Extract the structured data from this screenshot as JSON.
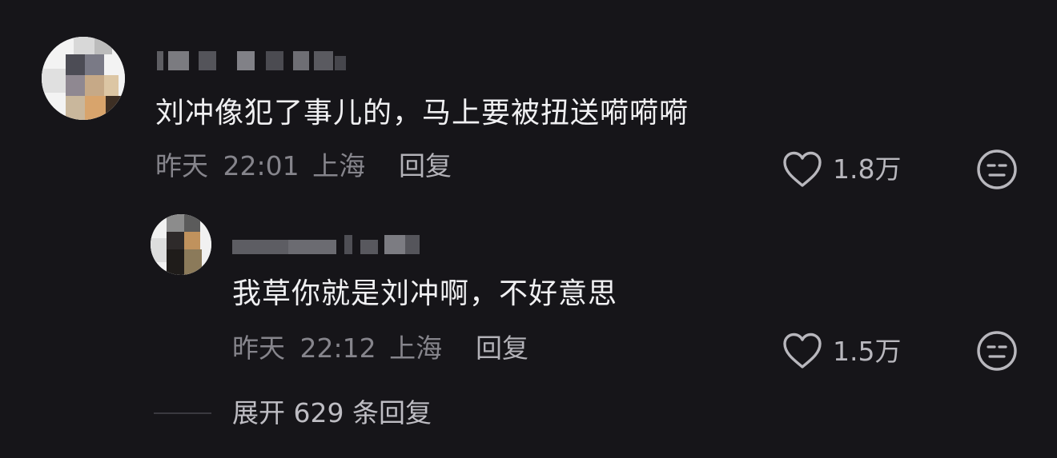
{
  "comments": [
    {
      "text": "刘冲像犯了事儿的，马上要被扭送嗬嗬嗬",
      "date": "昨天",
      "time": "22:01",
      "location": "上海",
      "reply_label": "回复",
      "likes": "1.8万"
    },
    {
      "text": "我草你就是刘冲啊，不好意思",
      "date": "昨天",
      "time": "22:12",
      "location": "上海",
      "reply_label": "回复",
      "likes": "1.5万"
    }
  ],
  "expand_replies": "展开 629 条回复",
  "icons": {
    "like": "heart-outline-icon",
    "dislike": "meh-face-icon"
  },
  "colors": {
    "background": "#161519",
    "text": "#f0f0f2",
    "meta": "#86858c"
  }
}
